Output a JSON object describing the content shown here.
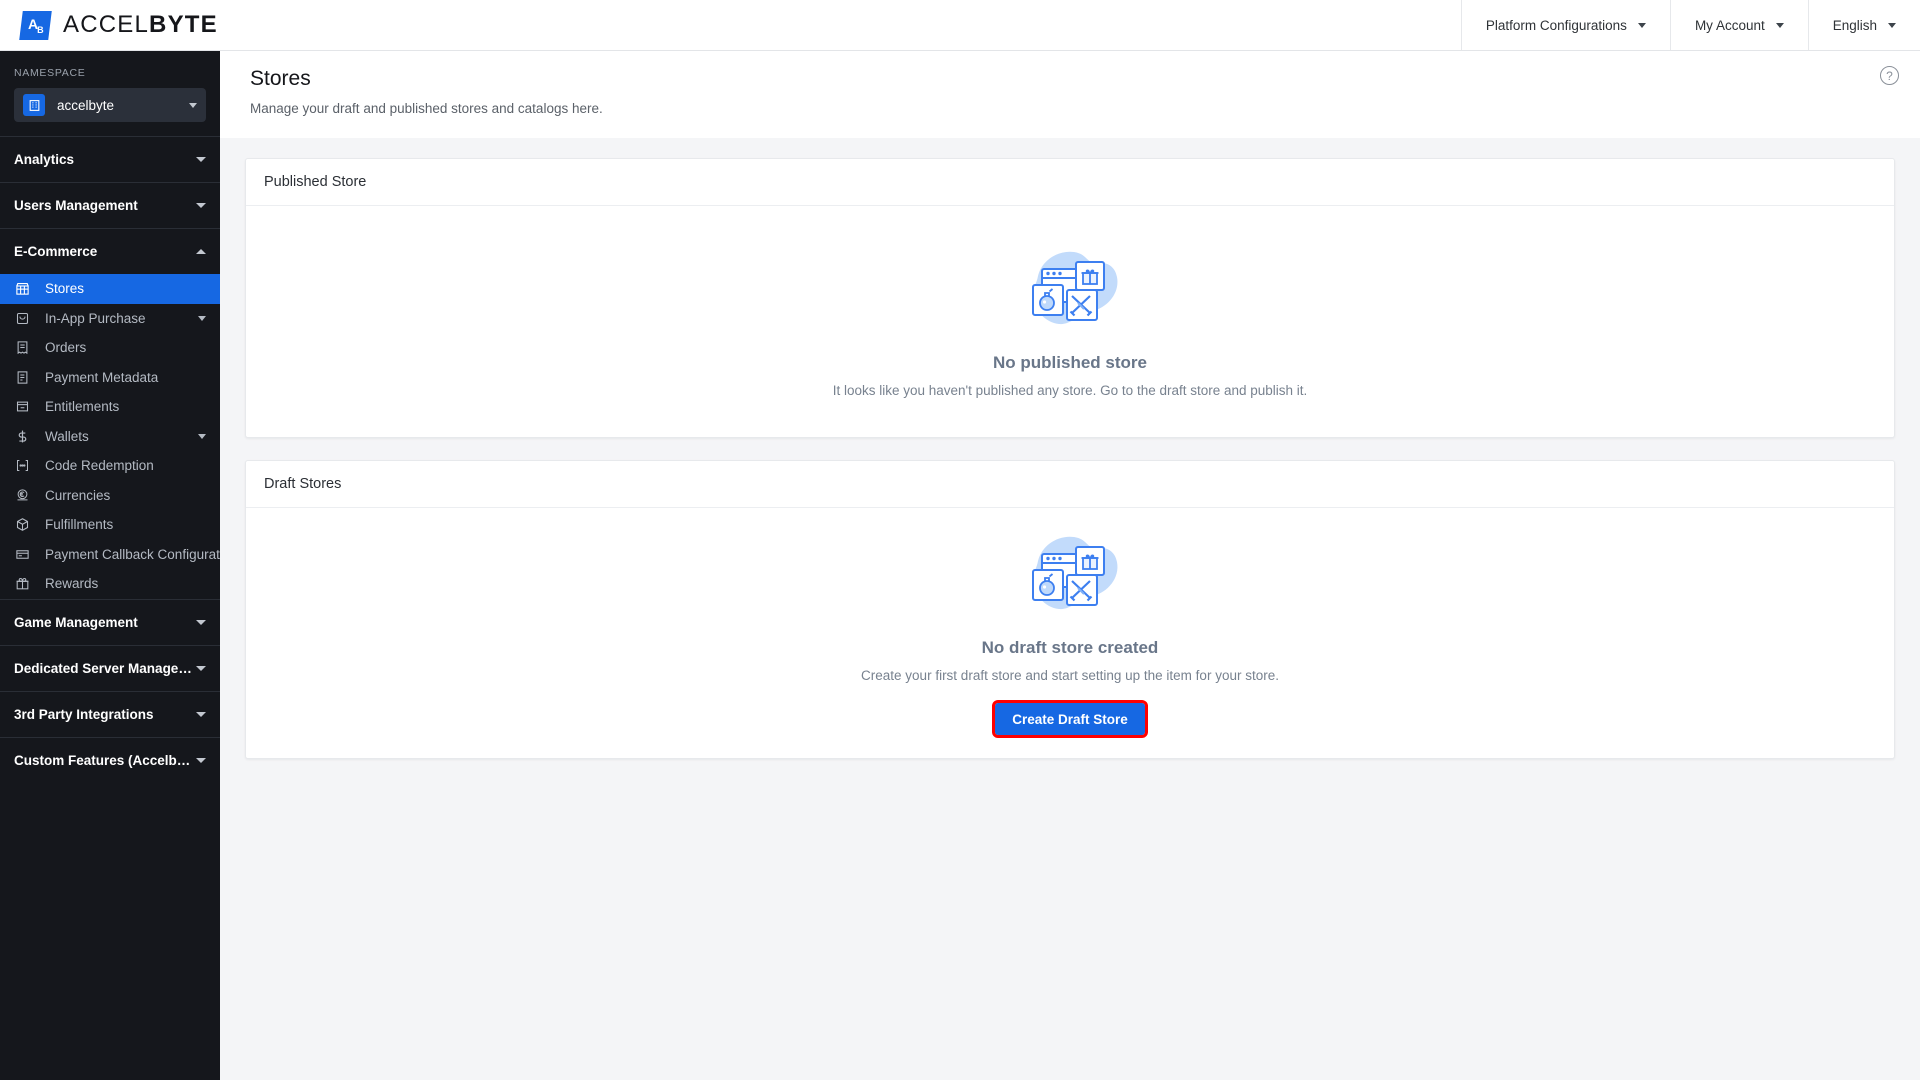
{
  "brand": {
    "logo_icon": "accelbyte-logo-icon",
    "name_light": "ACCEL",
    "name_bold": "BYTE",
    "full_name": "ACCELBYTE"
  },
  "topbar": {
    "menu": [
      {
        "label": "Platform Configurations",
        "icon": "chevron-down-icon"
      },
      {
        "label": "My Account",
        "icon": "chevron-down-icon"
      },
      {
        "label": "English",
        "icon": "chevron-down-icon"
      }
    ]
  },
  "sidebar": {
    "namespace_label": "NAMESPACE",
    "namespace_value": "accelbyte",
    "namespace_icon": "building-icon",
    "groups": [
      {
        "title": "Analytics",
        "expanded": false,
        "caret": "chevron-down-icon",
        "items": []
      },
      {
        "title": "Users Management",
        "expanded": false,
        "caret": "chevron-down-icon",
        "items": []
      },
      {
        "title": "E-Commerce",
        "expanded": true,
        "caret": "chevron-up-icon",
        "items": [
          {
            "label": "Stores",
            "icon": "store-icon",
            "active": true,
            "has_sub": false
          },
          {
            "label": "In-App Purchase",
            "icon": "bag-icon",
            "active": false,
            "has_sub": true
          },
          {
            "label": "Orders",
            "icon": "receipt-icon",
            "active": false,
            "has_sub": false
          },
          {
            "label": "Payment Metadata",
            "icon": "invoice-icon",
            "active": false,
            "has_sub": false
          },
          {
            "label": "Entitlements",
            "icon": "card-minus-icon",
            "active": false,
            "has_sub": false
          },
          {
            "label": "Wallets",
            "icon": "dollar-icon",
            "active": false,
            "has_sub": true
          },
          {
            "label": "Code Redemption",
            "icon": "code-icon",
            "active": false,
            "has_sub": false
          },
          {
            "label": "Currencies",
            "icon": "coin-euro-icon",
            "active": false,
            "has_sub": false
          },
          {
            "label": "Fulfillments",
            "icon": "box-icon",
            "active": false,
            "has_sub": false
          },
          {
            "label": "Payment Callback Configuration",
            "icon": "payment-card-icon",
            "active": false,
            "has_sub": false
          },
          {
            "label": "Rewards",
            "icon": "gift-icon",
            "active": false,
            "has_sub": false
          }
        ]
      },
      {
        "title": "Game Management",
        "expanded": false,
        "caret": "chevron-down-icon",
        "items": []
      },
      {
        "title": "Dedicated Server Management",
        "expanded": false,
        "caret": "chevron-down-icon",
        "items": []
      },
      {
        "title": "3rd Party Integrations",
        "expanded": false,
        "caret": "chevron-down-icon",
        "items": []
      },
      {
        "title": "Custom Features (Accelbyte In…",
        "expanded": false,
        "caret": "chevron-down-icon",
        "items": []
      }
    ]
  },
  "page": {
    "title": "Stores",
    "subtitle": "Manage your draft and published stores and catalogs here.",
    "help_icon": "help-circle-icon",
    "help_label": "?"
  },
  "published_store": {
    "card_title": "Published Store",
    "empty_title": "No published store",
    "empty_desc": "It looks like you haven't published any store. Go to the draft store and publish it.",
    "illustration": "store-items-illustration"
  },
  "draft_stores": {
    "card_title": "Draft Stores",
    "empty_title": "No draft store created",
    "empty_desc": "Create your first draft store and start setting up the item for your store.",
    "illustration": "store-items-illustration",
    "button_label": "Create Draft Store"
  },
  "colors": {
    "accent": "#1668e3",
    "sidebar_bg": "#15171c",
    "page_bg": "#f4f5f7",
    "highlight_outline": "#ff0000",
    "empty_title": "#697689",
    "illustration_blob": "#c2dbfb",
    "illustration_line": "#3d7ff0"
  }
}
